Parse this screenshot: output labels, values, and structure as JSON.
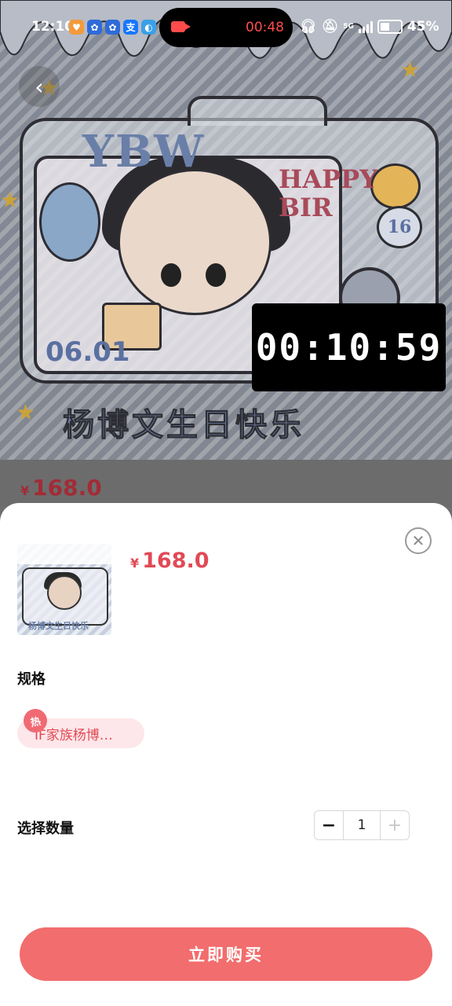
{
  "status_bar": {
    "time": "12:10",
    "app_icons": [
      "heart-app-icon",
      "app-icon",
      "app-icon",
      "alipay-icon",
      "browser-icon"
    ],
    "recording_time": "00:48",
    "network": "5G",
    "battery": "45%"
  },
  "banner": {
    "art_text_ybw": "YBW",
    "art_text_happy": "HAPPY BIR",
    "art_date": "06.01",
    "art_number": "16",
    "art_title": "杨博文生日快乐",
    "countdown": "00:10:59",
    "price_currency": "¥",
    "price": "168.0"
  },
  "sheet": {
    "thumb_caption": "杨博文生日快乐",
    "price_currency": "¥",
    "price": "168.0",
    "spec_label": "规格",
    "spec_option": "IF家族杨博…",
    "hot_badge": "热",
    "quantity_label": "选择数量",
    "quantity_value": "1",
    "buy_button": "立即购买"
  },
  "colors": {
    "accent": "#f26d6d",
    "price": "#e04a56",
    "chip_bg": "#fde7ea"
  }
}
